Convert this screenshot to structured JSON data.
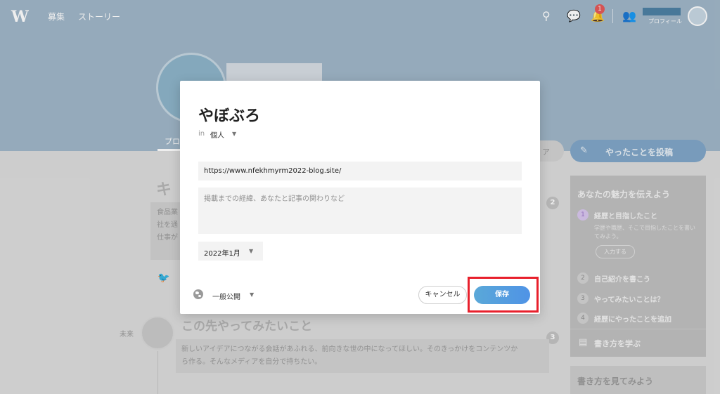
{
  "topnav": {
    "logo": "W",
    "links": [
      "募集",
      "ストーリー"
    ],
    "notification_count": "1",
    "profile_label": "プロフィール"
  },
  "background": {
    "tab_fragment": "プロ",
    "share_fragment": "ア",
    "post_button": "やったことを投稿",
    "heading_fragment": "キ",
    "story_fragment_lines": [
      "食品業",
      "社を通",
      "仕事が"
    ],
    "step_numbers": [
      "2",
      "3"
    ],
    "future": {
      "label": "未来",
      "title": "この先やってみたいこと",
      "text_line1": "新しいアイデアにつながる会話があふれる、前向きな世の中になってほしい。そのきっかけをコンテンツか",
      "text_line2": "ら作る。そんなメディアを自分で持ちたい。"
    }
  },
  "sidebar": {
    "title": "あなたの魅力を伝えよう",
    "steps": [
      {
        "num": "1",
        "label": "経歴と目指したこと"
      },
      {
        "num": "2",
        "label": "自己紹介を書こう"
      },
      {
        "num": "3",
        "label": "やってみたいことは？"
      },
      {
        "num": "4",
        "label": "経歴にやったことを追加"
      }
    ],
    "step1_desc": "学歴や職歴、そこで目指したことを書いてみよう。",
    "input_button": "入力する",
    "learn_link": "書き方を学ぶ",
    "see_examples": "書き方を見てみよう"
  },
  "modal": {
    "title": "やぼぶろ",
    "in_label": "in",
    "organization": "個人",
    "url_value": "https://www.nfekhmyrm2022-blog.site/",
    "description_placeholder": "掲載までの経緯、あなたと記事の関わりなど",
    "date": "2022年1月",
    "visibility": "一般公開",
    "cancel_label": "キャンセル",
    "save_label": "保存"
  },
  "colors": {
    "hero": "#9fb6c8",
    "save_gradient_start": "#5aa8d8",
    "save_gradient_end": "#4f93e6",
    "highlight": "#e8202c"
  }
}
